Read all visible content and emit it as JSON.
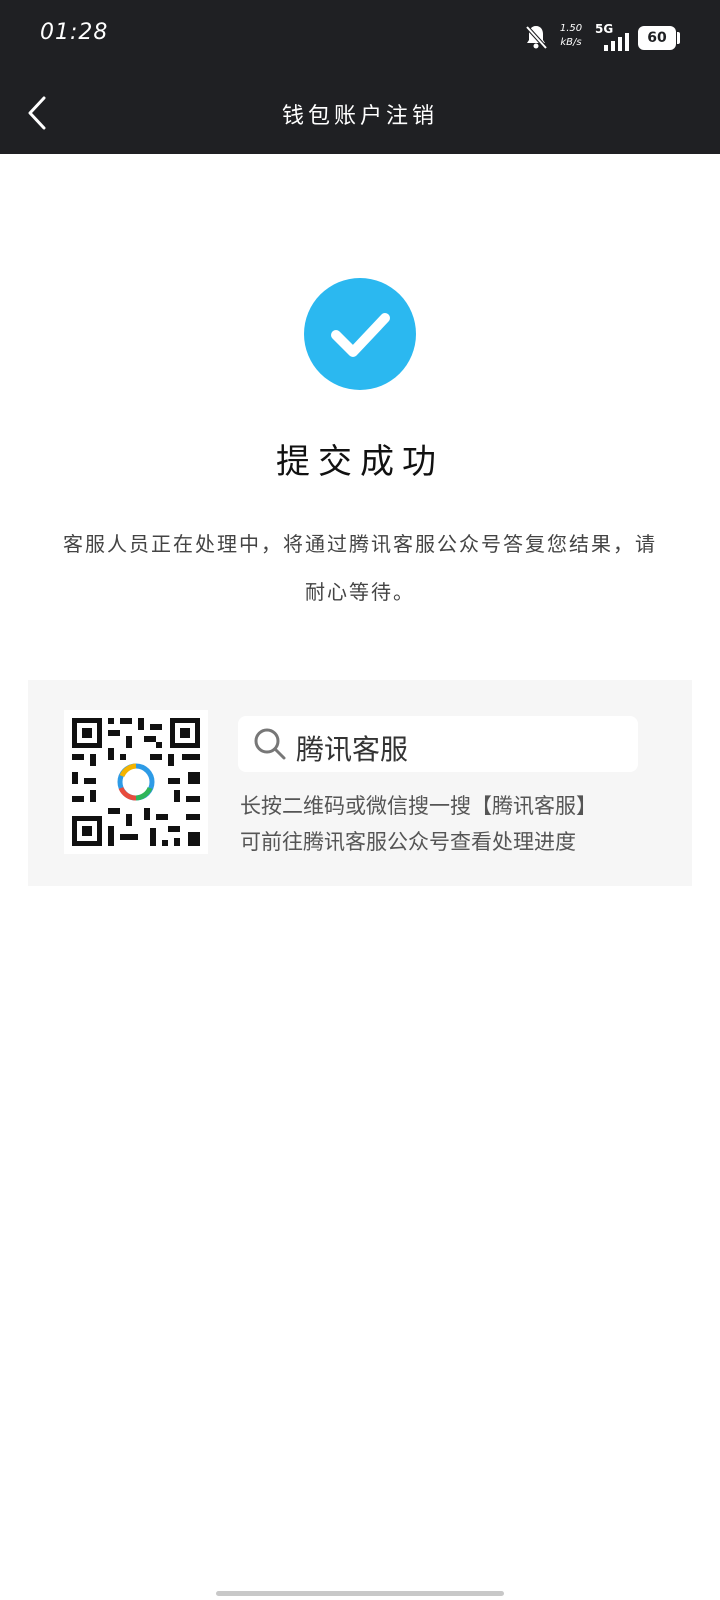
{
  "status_bar": {
    "time": "01:28",
    "speed_value": "1.50",
    "speed_unit": "kB/s",
    "network": "5G",
    "battery": "60"
  },
  "nav": {
    "title": "钱包账户注销",
    "back_icon": "chevron-left-icon"
  },
  "result": {
    "icon": "check-circle-icon",
    "icon_color": "#2bb8f0",
    "title": "提交成功",
    "description_line1": "客服人员正在处理中，将通过腾讯客服公众号答复您结果，请",
    "description_line2": "耐心等待。"
  },
  "card": {
    "qr_icon": "qr-code-icon",
    "search_icon": "search-icon",
    "search_text": "腾讯客服",
    "line1": "长按二维码或微信搜一搜【腾讯客服】",
    "line2": "可前往腾讯客服公众号查看处理进度"
  },
  "colors": {
    "header_bg": "#1f2023",
    "accent": "#2bb8f0",
    "card_bg": "#f6f6f6"
  }
}
